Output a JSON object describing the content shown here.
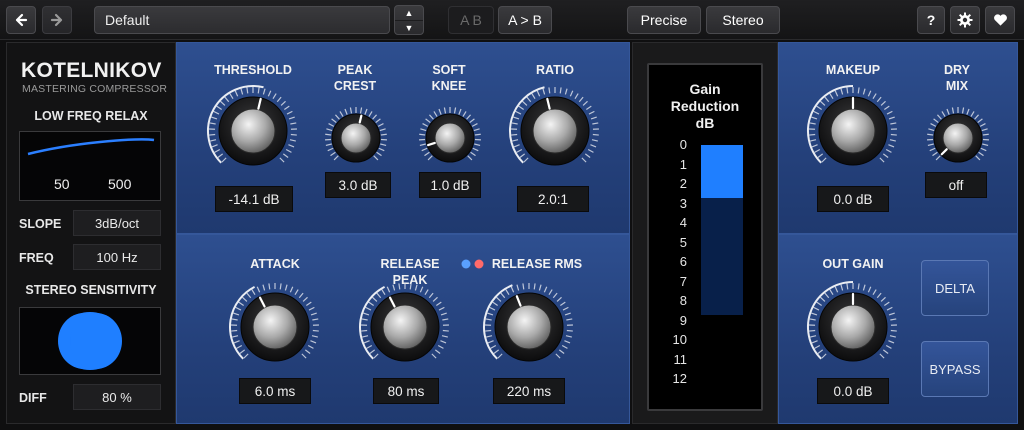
{
  "toolbar": {
    "back_icon": "arrow-left-icon",
    "forward_icon": "arrow-right-icon",
    "preset_name": "Default",
    "ab_label": "A B",
    "a_to_b_label": "A > B",
    "precise_label": "Precise",
    "stereo_label": "Stereo",
    "help_label": "?",
    "settings_icon": "gear-icon",
    "favorite_icon": "heart-icon"
  },
  "brand": {
    "name": "KOTELNIKOV",
    "subtitle": "MASTERING COMPRESSOR"
  },
  "left": {
    "low_freq_relax_label": "LOW FREQ RELAX",
    "freq_marks": [
      "50",
      "500"
    ],
    "slope_label": "SLOPE",
    "slope_value": "3dB/oct",
    "freq_label": "FREQ",
    "freq_value": "100 Hz",
    "stereo_sensitivity_label": "STEREO SENSITIVITY",
    "diff_label": "DIFF",
    "diff_value": "80 %"
  },
  "controls": {
    "threshold": {
      "label": "THRESHOLD",
      "value": "-14.1 dB",
      "level": 0.55
    },
    "peak_crest": {
      "label1": "PEAK",
      "label2": "CREST",
      "value": "3.0 dB",
      "level": 0.55
    },
    "soft_knee": {
      "label1": "SOFT",
      "label2": "KNEE",
      "value": "1.0 dB",
      "level": 0.1
    },
    "ratio": {
      "label": "RATIO",
      "value": "2.0:1",
      "level": 0.45
    },
    "attack": {
      "label": "ATTACK",
      "value": "6.0 ms",
      "level": 0.4
    },
    "release_peak": {
      "label": "RELEASE PEAK",
      "value": "80 ms",
      "level": 0.4
    },
    "release_rms": {
      "label": "RELEASE RMS",
      "value": "220 ms",
      "level": 0.42
    },
    "makeup": {
      "label": "MAKEUP",
      "value": "0.0 dB",
      "level": 0.5
    },
    "dry_mix": {
      "label1": "DRY",
      "label2": "MIX",
      "value": "off",
      "level": 0.0
    },
    "out_gain": {
      "label": "OUT GAIN",
      "value": "0.0 dB",
      "level": 0.5
    }
  },
  "meter": {
    "title_line1": "Gain",
    "title_line2": "Reduction",
    "title_line3": "dB",
    "scale": [
      "0",
      "1",
      "2",
      "3",
      "4",
      "5",
      "6",
      "7",
      "8",
      "9",
      "10",
      "11",
      "12"
    ],
    "gain_reduction_db": 2.7
  },
  "buttons": {
    "delta": "DELTA",
    "bypass": "BYPASS"
  },
  "colors": {
    "panel_blue": "#2a4a8a",
    "meter_blue": "#1f7fff",
    "meter_track": "#08204a",
    "arc_white": "#ffffff"
  }
}
